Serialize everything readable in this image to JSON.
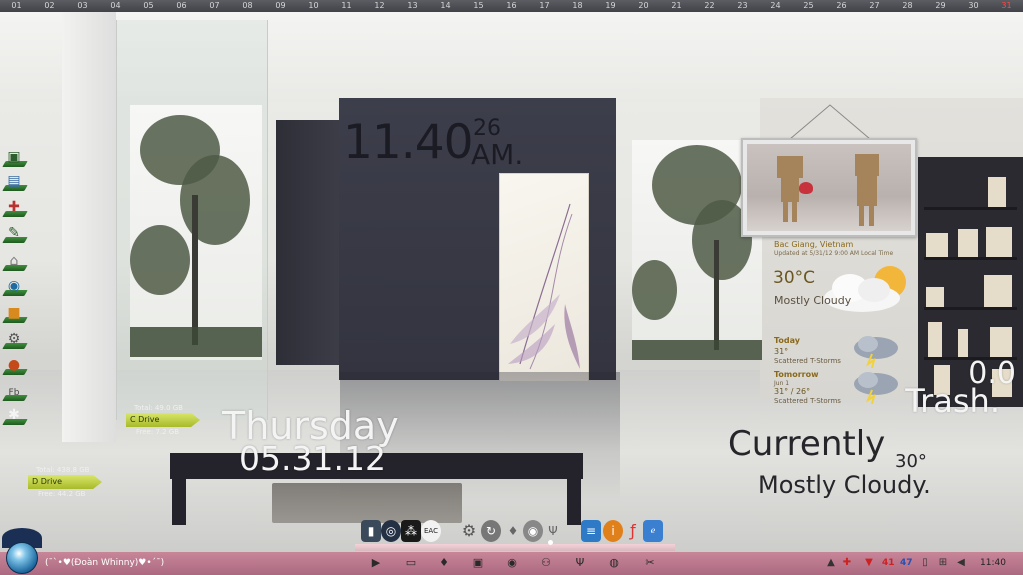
{
  "calendar": {
    "days": [
      "01",
      "02",
      "03",
      "04",
      "05",
      "06",
      "07",
      "08",
      "09",
      "10",
      "11",
      "12",
      "13",
      "14",
      "15",
      "16",
      "17",
      "18",
      "19",
      "20",
      "21",
      "22",
      "23",
      "24",
      "25",
      "26",
      "27",
      "28",
      "29",
      "30",
      "31"
    ],
    "today": "31"
  },
  "desktop_icons": [
    "computer-icon",
    "network-icon",
    "gift-icon",
    "pencil-icon",
    "home-icon",
    "globe-icon",
    "folder-icon",
    "settings-icon",
    "fire-icon",
    "facebook-icon",
    "runner-icon"
  ],
  "clock": {
    "time": "11.40",
    "seconds": "26",
    "ampm": "AM."
  },
  "weather": {
    "location": "Bac Giang, Vietnam",
    "updated": "Updated at 5/31/12 9:00 AM Local Time",
    "current_temp": "30°C",
    "current_condition": "Mostly Cloudy",
    "today_label": "Today",
    "today_temp": "31°",
    "today_desc": "Scattered T-Storms",
    "tomorrow_label": "Tomorrow",
    "tomorrow_date": "Jun 1",
    "tomorrow_temp": "31° / 26°",
    "tomorrow_desc": "Scattered T-Storms"
  },
  "trash": {
    "count": "0.0",
    "label": "Trash."
  },
  "currently": {
    "heading": "Currently",
    "temp": "30°",
    "condition": "Mostly Cloudy."
  },
  "date": {
    "day": "Thursday",
    "date": "05.31.12"
  },
  "drives": [
    {
      "name": "C Drive",
      "total": "Total: 49.0 GB",
      "free": "Free: 7.2 GB"
    },
    {
      "name": "D Drive",
      "total": "Total: 438.8 GB",
      "free": "Free: 44.2 GB"
    }
  ],
  "dock": {
    "eac_label": "EAC"
  },
  "taskbar": {
    "title": "(¯`•♥(Đoàn Whinny)♥•´¯)",
    "tray_num_1": "41",
    "tray_num_2": "47",
    "time": "11:40"
  },
  "colors": {
    "today": "#ff4a4a",
    "taskbar": "#c88296",
    "drive_tag": "#c6d64a"
  }
}
